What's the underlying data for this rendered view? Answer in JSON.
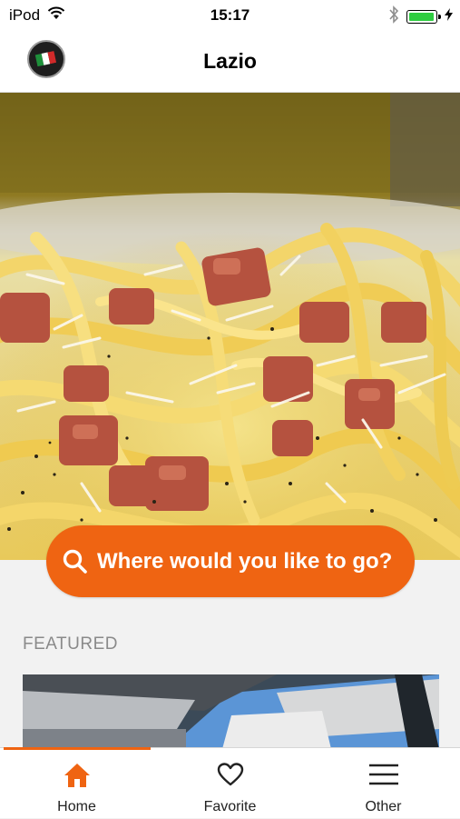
{
  "status_bar": {
    "carrier": "iPod",
    "time": "15:17"
  },
  "nav": {
    "title": "Lazio",
    "logo_icon": "italy-flag-badge-icon"
  },
  "hero": {
    "image": "spaghetti-carbonara-photo"
  },
  "search": {
    "placeholder": "Where would you like to go?",
    "icon": "search-icon"
  },
  "featured": {
    "section_label": "FEATURED",
    "image": "outdoor-umbrella-terrace-photo"
  },
  "tab_bar": {
    "tabs": [
      {
        "label": "Home",
        "icon": "home-icon",
        "active": true
      },
      {
        "label": "Favorite",
        "icon": "heart-icon",
        "active": false
      },
      {
        "label": "Other",
        "icon": "menu-icon",
        "active": false
      }
    ]
  },
  "colors": {
    "accent": "#ef6412",
    "battery": "#2ecc40",
    "section_label": "#8a8a8a"
  }
}
